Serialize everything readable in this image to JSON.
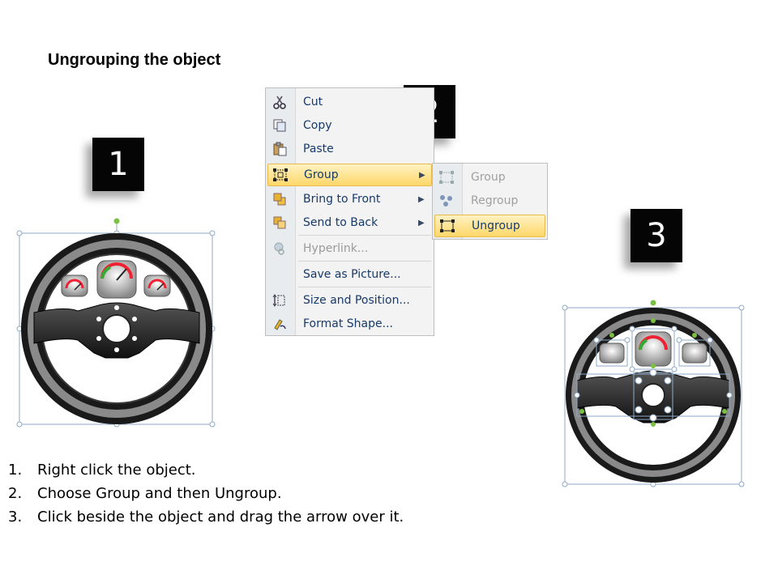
{
  "title": "Ungrouping the object",
  "badges": [
    "1",
    "2",
    "3"
  ],
  "context_menu": {
    "items": [
      {
        "label": "Cut",
        "icon": "scissors-icon"
      },
      {
        "label": "Copy",
        "icon": "copy-icon"
      },
      {
        "label": "Paste",
        "icon": "paste-icon"
      },
      {
        "label": "Group",
        "icon": "group-icon"
      },
      {
        "label": "Bring to Front",
        "icon": "bring-to-front-icon"
      },
      {
        "label": "Send to Back",
        "icon": "send-to-back-icon"
      },
      {
        "label": "Hyperlink...",
        "icon": "hyperlink-icon"
      },
      {
        "label": "Save as Picture...",
        "icon": ""
      },
      {
        "label": "Size and Position...",
        "icon": "size-position-icon"
      },
      {
        "label": "Format Shape...",
        "icon": "format-shape-icon"
      }
    ]
  },
  "submenu": {
    "items": [
      {
        "label": "Group",
        "icon": "group-icon"
      },
      {
        "label": "Regroup",
        "icon": "regroup-icon"
      },
      {
        "label": "Ungroup",
        "icon": "ungroup-icon"
      }
    ]
  },
  "steps": [
    {
      "num": "1.",
      "text": "Right click the object."
    },
    {
      "num": "2.",
      "text": "Choose Group and then Ungroup."
    },
    {
      "num": "3.",
      "text": "Click beside the object and drag the arrow over it."
    }
  ],
  "colors": {
    "highlight": "#ffd86a",
    "menu_text": "#163a6b",
    "handle": "#7ac143",
    "selection": "#8eaac8"
  }
}
